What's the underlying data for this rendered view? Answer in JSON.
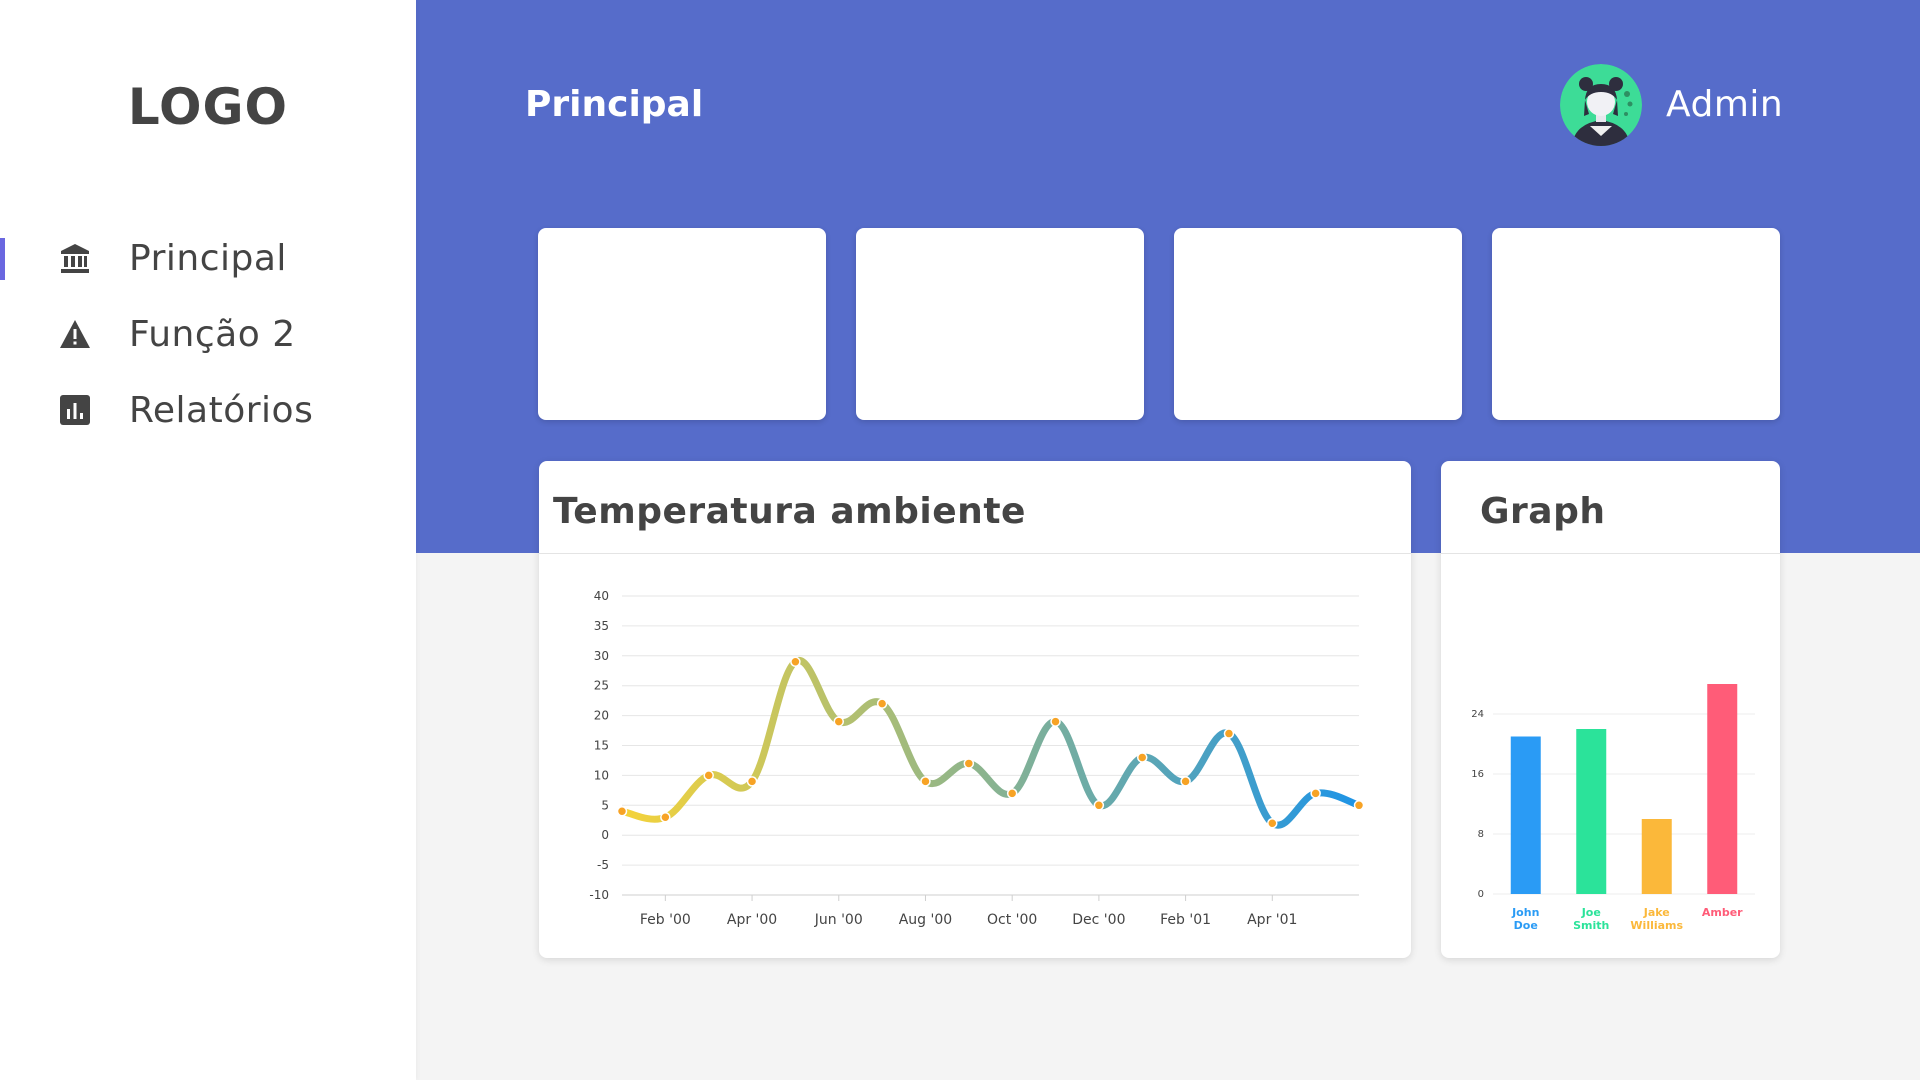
{
  "sidebar": {
    "logo": "LOGO",
    "items": [
      {
        "label": "Principal",
        "icon": "bank-icon",
        "active": true
      },
      {
        "label": "Função 2",
        "icon": "warning-icon",
        "active": false
      },
      {
        "label": "Relatórios",
        "icon": "bar-chart-icon",
        "active": false
      }
    ]
  },
  "header": {
    "title": "Principal",
    "user": "Admin"
  },
  "colors": {
    "header_bg": "#566cca",
    "accent": "#6a67e0",
    "avatar_bg": "#3ddc97"
  },
  "panels": {
    "temperature_title": "Temperatura ambiente",
    "graph_title": "Graph"
  },
  "chart_data": [
    {
      "type": "line",
      "title": "Temperatura ambiente",
      "xlabel": "",
      "ylabel": "",
      "ylim": [
        -10,
        40
      ],
      "yticks": [
        "40",
        "35",
        "30",
        "25",
        "20",
        "15",
        "10",
        "5",
        "0",
        "-5",
        "-10"
      ],
      "xtick_labels": [
        "Feb '00",
        "Apr '00",
        "Jun '00",
        "Aug '00",
        "Oct '00",
        "Dec '00",
        "Feb '01",
        "Apr '01"
      ],
      "grid": true,
      "gradient": [
        "#f5d33a",
        "#1e94e6"
      ],
      "series": [
        {
          "x": [
            "2000-01",
            "2000-02",
            "2000-03",
            "2000-04",
            "2000-05",
            "2000-06",
            "2000-07",
            "2000-08",
            "2000-09",
            "2000-10",
            "2000-11",
            "2000-12",
            "2001-01",
            "2001-02",
            "2001-03",
            "2001-04",
            "2001-05",
            "2001-06"
          ],
          "values": [
            4,
            3,
            10,
            9,
            29,
            19,
            22,
            9,
            12,
            7,
            19,
            5,
            13,
            9,
            17,
            2,
            7,
            5
          ]
        }
      ]
    },
    {
      "type": "bar",
      "title": "Graph",
      "categories": [
        [
          "John",
          "Doe"
        ],
        [
          "Joe",
          "Smith"
        ],
        [
          "Jake",
          "Williams"
        ],
        [
          "Amber"
        ]
      ],
      "values": [
        21,
        22,
        10,
        28
      ],
      "colors": [
        "#2a9bf5",
        "#2be39a",
        "#fbb83a",
        "#ff5c78"
      ],
      "yticks": [
        "0",
        "8",
        "16",
        "24"
      ],
      "ylim": [
        0,
        30
      ],
      "grid": true
    }
  ]
}
